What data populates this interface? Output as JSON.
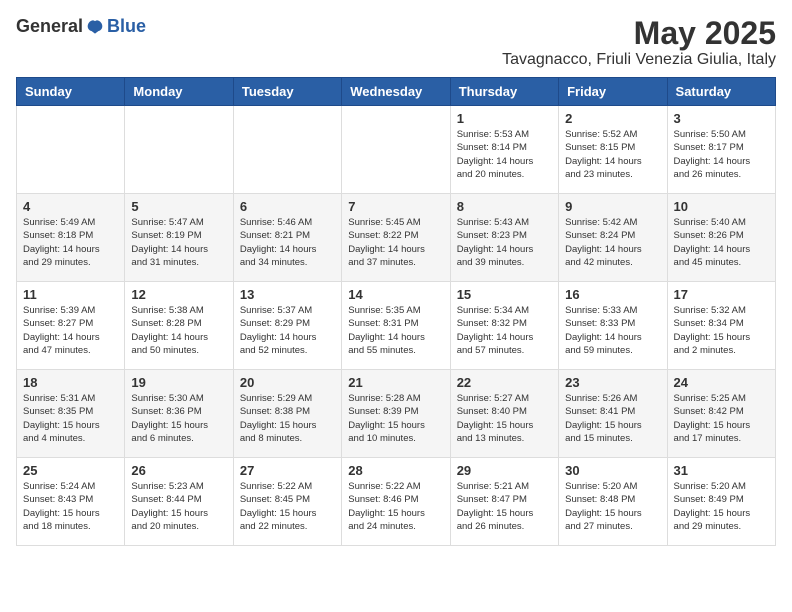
{
  "logo": {
    "general": "General",
    "blue": "Blue"
  },
  "title": {
    "month": "May 2025",
    "location": "Tavagnacco, Friuli Venezia Giulia, Italy"
  },
  "weekdays": [
    "Sunday",
    "Monday",
    "Tuesday",
    "Wednesday",
    "Thursday",
    "Friday",
    "Saturday"
  ],
  "weeks": [
    [
      {
        "day": "",
        "info": ""
      },
      {
        "day": "",
        "info": ""
      },
      {
        "day": "",
        "info": ""
      },
      {
        "day": "",
        "info": ""
      },
      {
        "day": "1",
        "info": "Sunrise: 5:53 AM\nSunset: 8:14 PM\nDaylight: 14 hours\nand 20 minutes."
      },
      {
        "day": "2",
        "info": "Sunrise: 5:52 AM\nSunset: 8:15 PM\nDaylight: 14 hours\nand 23 minutes."
      },
      {
        "day": "3",
        "info": "Sunrise: 5:50 AM\nSunset: 8:17 PM\nDaylight: 14 hours\nand 26 minutes."
      }
    ],
    [
      {
        "day": "4",
        "info": "Sunrise: 5:49 AM\nSunset: 8:18 PM\nDaylight: 14 hours\nand 29 minutes."
      },
      {
        "day": "5",
        "info": "Sunrise: 5:47 AM\nSunset: 8:19 PM\nDaylight: 14 hours\nand 31 minutes."
      },
      {
        "day": "6",
        "info": "Sunrise: 5:46 AM\nSunset: 8:21 PM\nDaylight: 14 hours\nand 34 minutes."
      },
      {
        "day": "7",
        "info": "Sunrise: 5:45 AM\nSunset: 8:22 PM\nDaylight: 14 hours\nand 37 minutes."
      },
      {
        "day": "8",
        "info": "Sunrise: 5:43 AM\nSunset: 8:23 PM\nDaylight: 14 hours\nand 39 minutes."
      },
      {
        "day": "9",
        "info": "Sunrise: 5:42 AM\nSunset: 8:24 PM\nDaylight: 14 hours\nand 42 minutes."
      },
      {
        "day": "10",
        "info": "Sunrise: 5:40 AM\nSunset: 8:26 PM\nDaylight: 14 hours\nand 45 minutes."
      }
    ],
    [
      {
        "day": "11",
        "info": "Sunrise: 5:39 AM\nSunset: 8:27 PM\nDaylight: 14 hours\nand 47 minutes."
      },
      {
        "day": "12",
        "info": "Sunrise: 5:38 AM\nSunset: 8:28 PM\nDaylight: 14 hours\nand 50 minutes."
      },
      {
        "day": "13",
        "info": "Sunrise: 5:37 AM\nSunset: 8:29 PM\nDaylight: 14 hours\nand 52 minutes."
      },
      {
        "day": "14",
        "info": "Sunrise: 5:35 AM\nSunset: 8:31 PM\nDaylight: 14 hours\nand 55 minutes."
      },
      {
        "day": "15",
        "info": "Sunrise: 5:34 AM\nSunset: 8:32 PM\nDaylight: 14 hours\nand 57 minutes."
      },
      {
        "day": "16",
        "info": "Sunrise: 5:33 AM\nSunset: 8:33 PM\nDaylight: 14 hours\nand 59 minutes."
      },
      {
        "day": "17",
        "info": "Sunrise: 5:32 AM\nSunset: 8:34 PM\nDaylight: 15 hours\nand 2 minutes."
      }
    ],
    [
      {
        "day": "18",
        "info": "Sunrise: 5:31 AM\nSunset: 8:35 PM\nDaylight: 15 hours\nand 4 minutes."
      },
      {
        "day": "19",
        "info": "Sunrise: 5:30 AM\nSunset: 8:36 PM\nDaylight: 15 hours\nand 6 minutes."
      },
      {
        "day": "20",
        "info": "Sunrise: 5:29 AM\nSunset: 8:38 PM\nDaylight: 15 hours\nand 8 minutes."
      },
      {
        "day": "21",
        "info": "Sunrise: 5:28 AM\nSunset: 8:39 PM\nDaylight: 15 hours\nand 10 minutes."
      },
      {
        "day": "22",
        "info": "Sunrise: 5:27 AM\nSunset: 8:40 PM\nDaylight: 15 hours\nand 13 minutes."
      },
      {
        "day": "23",
        "info": "Sunrise: 5:26 AM\nSunset: 8:41 PM\nDaylight: 15 hours\nand 15 minutes."
      },
      {
        "day": "24",
        "info": "Sunrise: 5:25 AM\nSunset: 8:42 PM\nDaylight: 15 hours\nand 17 minutes."
      }
    ],
    [
      {
        "day": "25",
        "info": "Sunrise: 5:24 AM\nSunset: 8:43 PM\nDaylight: 15 hours\nand 18 minutes."
      },
      {
        "day": "26",
        "info": "Sunrise: 5:23 AM\nSunset: 8:44 PM\nDaylight: 15 hours\nand 20 minutes."
      },
      {
        "day": "27",
        "info": "Sunrise: 5:22 AM\nSunset: 8:45 PM\nDaylight: 15 hours\nand 22 minutes."
      },
      {
        "day": "28",
        "info": "Sunrise: 5:22 AM\nSunset: 8:46 PM\nDaylight: 15 hours\nand 24 minutes."
      },
      {
        "day": "29",
        "info": "Sunrise: 5:21 AM\nSunset: 8:47 PM\nDaylight: 15 hours\nand 26 minutes."
      },
      {
        "day": "30",
        "info": "Sunrise: 5:20 AM\nSunset: 8:48 PM\nDaylight: 15 hours\nand 27 minutes."
      },
      {
        "day": "31",
        "info": "Sunrise: 5:20 AM\nSunset: 8:49 PM\nDaylight: 15 hours\nand 29 minutes."
      }
    ]
  ]
}
